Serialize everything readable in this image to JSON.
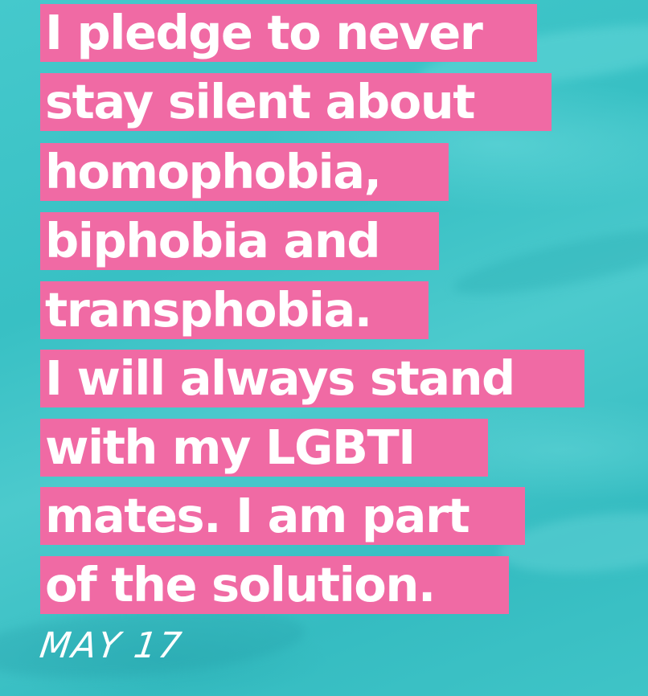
{
  "pledge": {
    "lines": [
      "I pledge to never",
      "stay silent about",
      "homophobia,",
      "biphobia and",
      "transphobia.",
      "I will always stand",
      "with my LGBTI",
      "mates. I am part",
      "of the solution."
    ],
    "date_mark": "MAY 17"
  },
  "colors": {
    "background": "#3ec4c8",
    "highlight": "#f06aa4",
    "text": "#ffffff"
  }
}
